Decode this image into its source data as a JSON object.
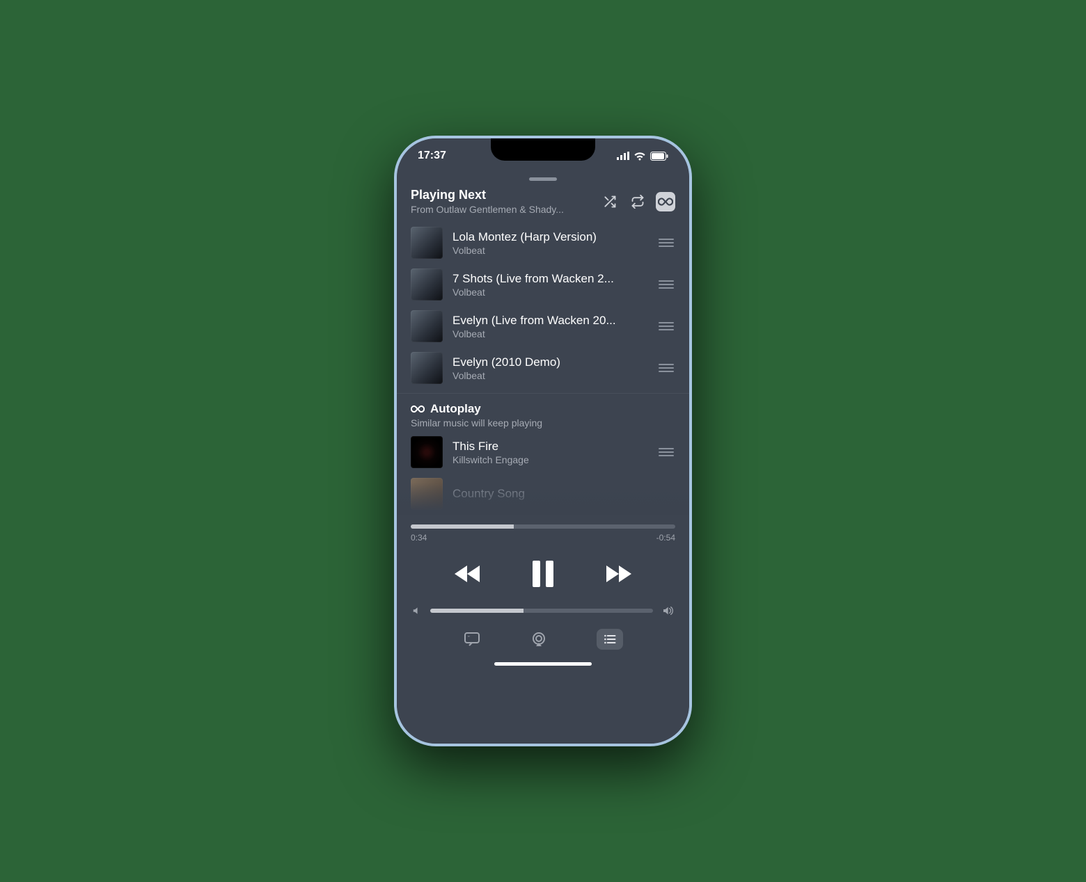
{
  "status": {
    "time": "17:37"
  },
  "header": {
    "title": "Playing Next",
    "subtitle": "From Outlaw Gentlemen & Shady..."
  },
  "queue": [
    {
      "title": "Lola Montez (Harp Version)",
      "artist": "Volbeat"
    },
    {
      "title": "7 Shots (Live from Wacken 2...",
      "artist": "Volbeat"
    },
    {
      "title": "Evelyn (Live from Wacken 20...",
      "artist": "Volbeat"
    },
    {
      "title": "Evelyn (2010 Demo)",
      "artist": "Volbeat"
    }
  ],
  "autoplay": {
    "label": "Autoplay",
    "sub": "Similar music will keep playing",
    "items": [
      {
        "title": "This Fire",
        "artist": "Killswitch Engage"
      },
      {
        "title": "Country Song",
        "artist": ""
      }
    ]
  },
  "player": {
    "elapsed": "0:34",
    "remaining": "-0:54",
    "progress_pct": 39,
    "volume_pct": 42
  }
}
